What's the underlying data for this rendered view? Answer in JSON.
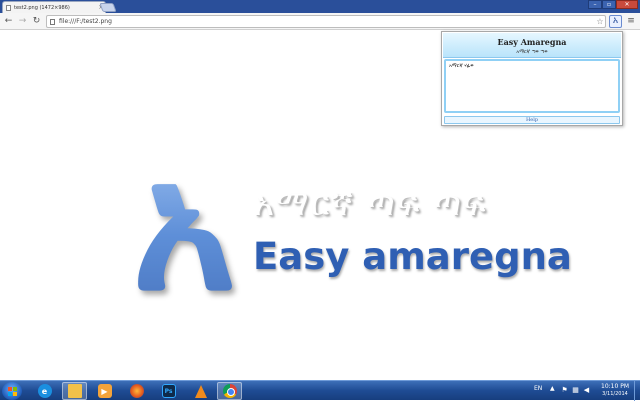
{
  "browser": {
    "tab": {
      "title": "test2.png (1472×986)",
      "close": "×"
    },
    "window_controls": {
      "minimize": "–",
      "maximize": "▫",
      "close": "✕"
    },
    "toolbar": {
      "back": "←",
      "forward": "→",
      "reload": "↻",
      "url": "file:///F:/test2.png",
      "star": "☆",
      "extension_glyph": "አ",
      "menu": "≡"
    }
  },
  "content": {
    "logo_glyph": "አ",
    "logo_amharic": "አማርኛ ጣፍ ጣፍ",
    "logo_english": "Easy amaregna"
  },
  "popup": {
    "title": "Easy Amaregna",
    "subtitle": "አማርኛ ጣፍ ጣፍ",
    "textarea_value": "አማርኛ ሃፊፍ",
    "help_label": "Help"
  },
  "taskbar": {
    "apps": [
      "internet-explorer",
      "windows-explorer",
      "media-player",
      "firefox",
      "photoshop",
      "vlc",
      "chrome"
    ],
    "photoshop_label": "Ps",
    "language": "EN",
    "chevron": "▲",
    "time": "10:10 PM",
    "date": "3/11/2014"
  },
  "colors": {
    "accent_blue": "#2f5fb3",
    "taskbar": "#1f4c94",
    "popup_header": "#b9e4fb"
  }
}
